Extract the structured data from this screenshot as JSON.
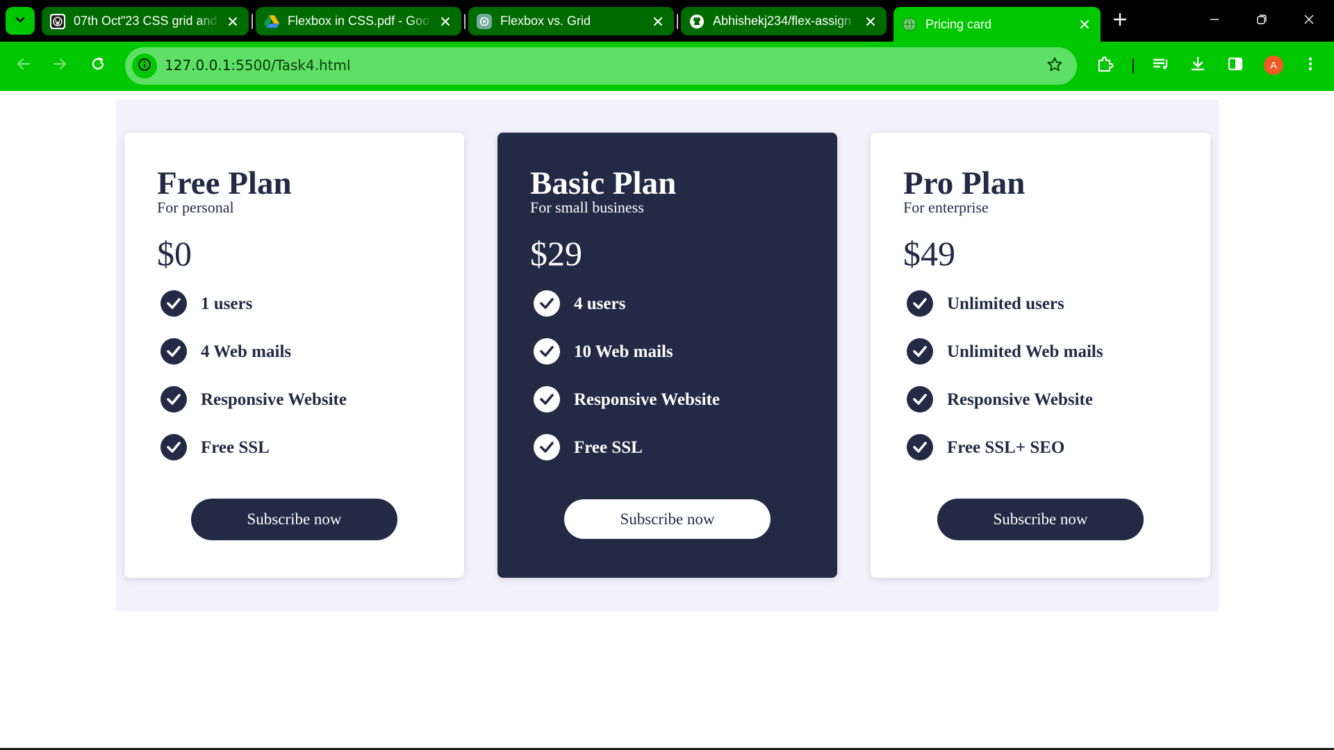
{
  "browser": {
    "tabs": [
      {
        "title": "07th Oct\"23 CSS grid and",
        "icon": "wordpress-icon",
        "active": false
      },
      {
        "title": "Flexbox in CSS.pdf - Goo",
        "icon": "google-drive-icon",
        "active": false
      },
      {
        "title": "Flexbox vs. Grid",
        "icon": "chatgpt-icon",
        "active": false
      },
      {
        "title": "Abhishekj234/flex-assign",
        "icon": "github-icon",
        "active": false
      },
      {
        "title": "Pricing card",
        "icon": "globe-icon",
        "active": true
      }
    ],
    "url": {
      "host": "127.0.0.1",
      "path": ":5500/Task4.html"
    },
    "avatar_letter": "A",
    "theme_color": "#00c800"
  },
  "page": {
    "title": "Pricing card",
    "accent_color": "#222a45",
    "plans": [
      {
        "name": "Free Plan",
        "subtitle": "For personal",
        "price": "$0",
        "features": [
          "1 users",
          "4 Web mails",
          "Responsive Website",
          "Free SSL"
        ],
        "button": "Subscribe now",
        "theme": "light"
      },
      {
        "name": "Basic Plan",
        "subtitle": "For small business",
        "price": "$29",
        "features": [
          "4 users",
          "10 Web mails",
          "Responsive Website",
          "Free SSL"
        ],
        "button": "Subscribe now",
        "theme": "dark"
      },
      {
        "name": "Pro Plan",
        "subtitle": "For enterprise",
        "price": "$49",
        "features": [
          "Unlimited users",
          "Unlimited Web mails",
          "Responsive Website",
          "Free SSL+ SEO"
        ],
        "button": "Subscribe now",
        "theme": "light"
      }
    ]
  }
}
